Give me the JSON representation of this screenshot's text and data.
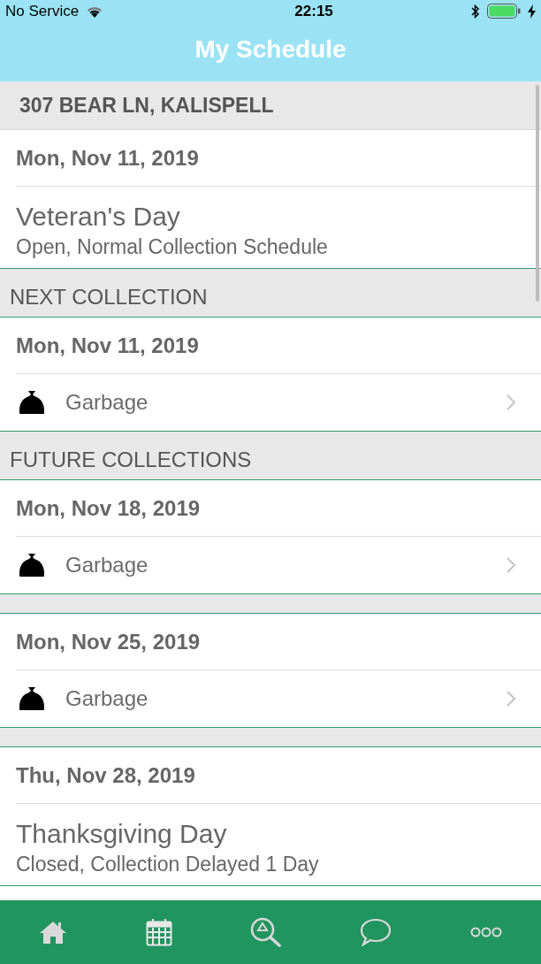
{
  "status_bar": {
    "carrier": "No Service",
    "time": "22:15"
  },
  "title": "My Schedule",
  "address": "307 BEAR LN, KALISPELL",
  "sections": [
    {
      "groups": [
        {
          "kind": "holiday",
          "date": "Mon, Nov 11, 2019",
          "title": "Veteran's Day",
          "subtitle": "Open, Normal Collection Schedule"
        }
      ]
    },
    {
      "heading": "NEXT COLLECTION",
      "groups": [
        {
          "kind": "collection",
          "date": "Mon, Nov 11, 2019",
          "items": [
            {
              "label": "Garbage"
            }
          ]
        }
      ]
    },
    {
      "heading": "FUTURE COLLECTIONS",
      "groups": [
        {
          "kind": "collection",
          "date": "Mon, Nov 18, 2019",
          "items": [
            {
              "label": "Garbage"
            }
          ]
        },
        {
          "kind": "collection",
          "date": "Mon, Nov 25, 2019",
          "items": [
            {
              "label": "Garbage"
            }
          ]
        },
        {
          "kind": "holiday",
          "date": "Thu, Nov 28, 2019",
          "title": "Thanksgiving Day",
          "subtitle": "Closed, Collection Delayed 1 Day"
        }
      ]
    }
  ],
  "tab_bar": [
    {
      "kind": "home"
    },
    {
      "kind": "calendar"
    },
    {
      "kind": "search"
    },
    {
      "kind": "chat"
    },
    {
      "kind": "more"
    }
  ]
}
